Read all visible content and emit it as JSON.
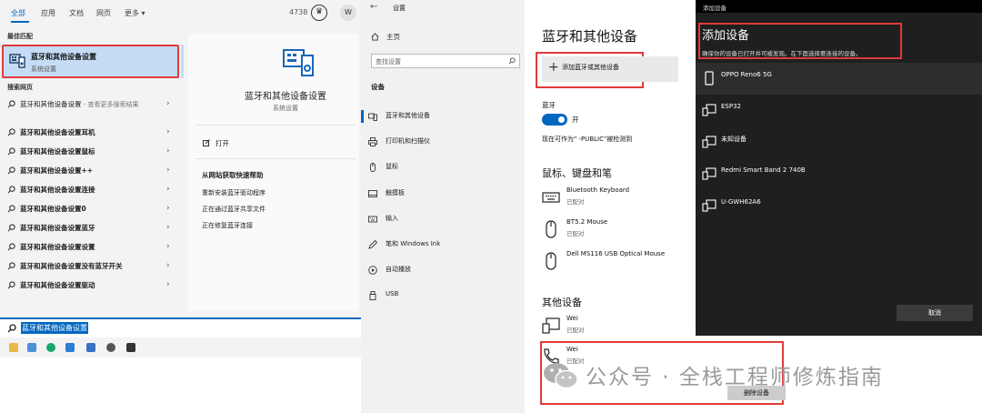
{
  "colors": {
    "accent": "#0067c0",
    "highlight": "#e13a3a",
    "dark_bg": "#1f1f1f"
  },
  "search": {
    "tabs": [
      "全部",
      "应用",
      "文档",
      "网页",
      "更多 ▾"
    ],
    "points": "4738",
    "avatar_letter": "W",
    "best_match_header": "最佳匹配",
    "best_match": {
      "title": "蓝牙和其他设备设置",
      "subtitle": "系统设置",
      "icon": "bluetooth-settings-icon"
    },
    "web_header": "搜索网页",
    "web_items": [
      {
        "query": "蓝牙和其他设备设置",
        "suffix": " - 查看更多搜索结果"
      },
      {
        "query": "蓝牙和其他设备设置耳机",
        "suffix": ""
      },
      {
        "query": "蓝牙和其他设备设置鼠标",
        "suffix": ""
      },
      {
        "query": "蓝牙和其他设备设置++",
        "suffix": ""
      },
      {
        "query": "蓝牙和其他设备设置连接",
        "suffix": ""
      },
      {
        "query": "蓝牙和其他设备设置0",
        "suffix": ""
      },
      {
        "query": "蓝牙和其他设备设置蓝牙",
        "suffix": ""
      },
      {
        "query": "蓝牙和其他设备设置设置",
        "suffix": ""
      },
      {
        "query": "蓝牙和其他设备设置没有蓝牙开关",
        "suffix": ""
      },
      {
        "query": "蓝牙和其他设备设置驱动",
        "suffix": ""
      }
    ],
    "detail": {
      "title": "蓝牙和其他设备设置",
      "subtitle": "系统设置",
      "open_label": "打开",
      "help_header": "从网站获取快速帮助",
      "help_items": [
        "重新安装蓝牙驱动程序",
        "正在通过蓝牙共享文件",
        "正在修复蓝牙连接"
      ]
    },
    "query": "蓝牙和其他设备设置",
    "taskbar_icons": [
      "file-explorer-icon",
      "store-icon",
      "edge-icon",
      "mail-icon",
      "photos-icon",
      "settings-icon",
      "terminal-icon"
    ]
  },
  "settings": {
    "app_title": "设置",
    "home": "主页",
    "find_placeholder": "查找设置",
    "nav_header": "设备",
    "nav_items": [
      {
        "label": "蓝牙和其他设备",
        "icon": "bluetooth-icon",
        "selected": true
      },
      {
        "label": "打印机和扫描仪",
        "icon": "printer-icon",
        "selected": false
      },
      {
        "label": "鼠标",
        "icon": "mouse-icon",
        "selected": false
      },
      {
        "label": "触摸板",
        "icon": "touchpad-icon",
        "selected": false
      },
      {
        "label": "输入",
        "icon": "keyboard-icon",
        "selected": false
      },
      {
        "label": "笔和 Windows Ink",
        "icon": "pen-icon",
        "selected": false
      },
      {
        "label": "自动播放",
        "icon": "autoplay-icon",
        "selected": false
      },
      {
        "label": "USB",
        "icon": "usb-icon",
        "selected": false
      }
    ],
    "page_title": "蓝牙和其他设备",
    "add_device_label": "添加蓝牙或其他设备",
    "bluetooth_header": "蓝牙",
    "toggle_state": "开",
    "discoverable_text": "现在可作为\"       -PUBLIC\"被检测到",
    "section_input": "鼠标、键盘和笔",
    "input_devices": [
      {
        "name": "Bluetooth Keyboard",
        "status": "已配对",
        "icon": "keyboard-icon"
      },
      {
        "name": "BT5.2 Mouse",
        "status": "已配对",
        "icon": "mouse-icon"
      },
      {
        "name": "Dell MS116 USB Optical Mouse",
        "status": "",
        "icon": "mouse-icon"
      }
    ],
    "section_other": "其他设备",
    "other_devices": [
      {
        "name": "Wei",
        "status": "已配对",
        "icon": "device-icon"
      },
      {
        "name": "Wei",
        "status": "已配对",
        "icon": "phone-icon"
      }
    ],
    "remove_label": "删除设备"
  },
  "dialog": {
    "window_title": "添加设备",
    "title": "添加设备",
    "description": "确保你的设备已打开并可被发现。在下面选择要连接的设备。",
    "devices": [
      "OPPO Reno6 5G",
      "ESP32",
      "未知设备",
      "Redmi Smart Band 2 740B",
      "U-GWH62A6"
    ],
    "cancel_label": "取消"
  },
  "watermark": {
    "text": "公众号 · 全栈工程师修炼指南"
  }
}
